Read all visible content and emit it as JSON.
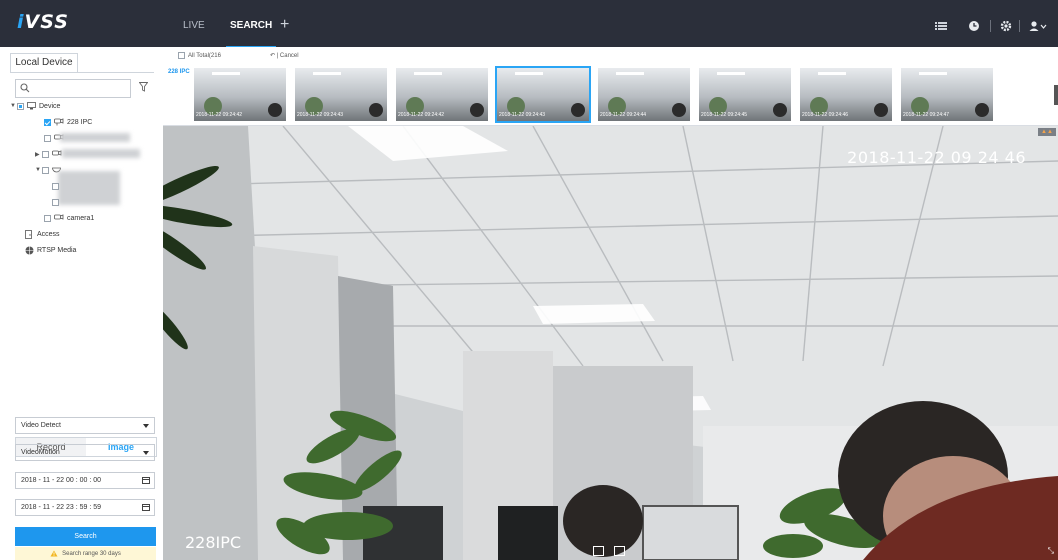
{
  "app": {
    "logo_prefix": "i",
    "logo_rest": "VSS"
  },
  "topnav": {
    "tabs": [
      {
        "label": "LIVE"
      },
      {
        "label": "SEARCH"
      }
    ],
    "add_label": "+",
    "icons": [
      "list-icon",
      "clock-icon",
      "settings-icon",
      "user-icon"
    ]
  },
  "left": {
    "tab_label": "Local Device",
    "search_placeholder": "",
    "tree": {
      "device_label": "Device",
      "ipc_label": "228 IPC",
      "camera1_label": "camera1",
      "access_label": "Access",
      "rtsp_label": "RTSP Media"
    },
    "search_type_tabs": [
      {
        "label": "Record"
      },
      {
        "label": "Image"
      }
    ],
    "event_type": "Video Detect",
    "event_subtype": "VideoMotion",
    "start_time": "2018 - 11 - 22  00 : 00 : 00",
    "end_time": "2018 - 11 - 22  23 : 59 : 59",
    "search_label": "Search",
    "hint_text": "Search range 30 days"
  },
  "results": {
    "all_total_label": "All Total(216",
    "cancel_label": "Cancel",
    "camera_label": "228 IPC",
    "selected_index": 3,
    "thumbnails": [
      {
        "time": "2018-11-22 09:24:42"
      },
      {
        "time": "2018-11-22 09:24:43"
      },
      {
        "time": "2018-11-22 09:24:42"
      },
      {
        "time": "2018-11-22 09:24:43"
      },
      {
        "time": "2018-11-22 09:24:44"
      },
      {
        "time": "2018-11-22 09:24:45"
      },
      {
        "time": "2018-11-22 09:24:46"
      },
      {
        "time": "2018-11-22 09:24:47"
      }
    ]
  },
  "video": {
    "timestamp": "2018-11-22 09 24 46",
    "camera_name": "228IPC"
  }
}
